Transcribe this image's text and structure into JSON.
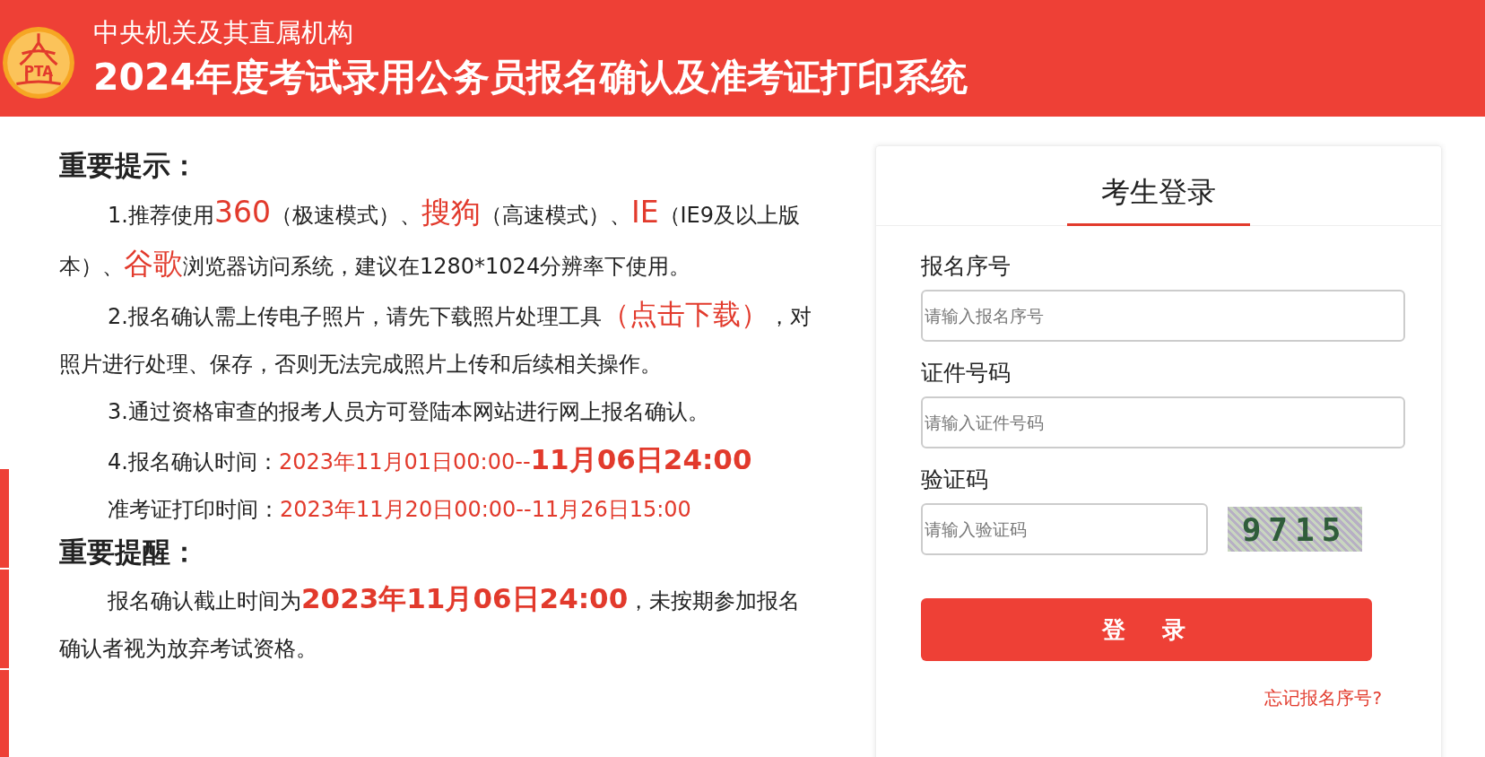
{
  "header": {
    "logo_text": "PTA",
    "subtitle": "中央机关及其直属机构",
    "title": "2024年度考试录用公务员报名确认及准考证打印系统"
  },
  "side_tabs": [
    {
      "kind": "tab"
    },
    {
      "kind": "tab"
    },
    {
      "kind": "tab"
    }
  ],
  "notice": {
    "heading": "重要提示：",
    "paragraphs": [
      {
        "segments": [
          {
            "kind": "plain",
            "text": "1.推荐使用"
          },
          {
            "kind": "highlight",
            "text": "360"
          },
          {
            "kind": "plain",
            "text": "（极速模式）、"
          },
          {
            "kind": "highlight",
            "text": "搜狗"
          },
          {
            "kind": "plain",
            "text": "（高速模式）、"
          },
          {
            "kind": "highlight",
            "text": "IE"
          },
          {
            "kind": "plain",
            "text": "（IE9及以上版本）、"
          },
          {
            "kind": "highlight",
            "text": "谷歌"
          },
          {
            "kind": "plain",
            "text": "浏览器访问系统，建议在1280*1024分辨率下使用。"
          }
        ]
      },
      {
        "segments": [
          {
            "kind": "plain",
            "text": "2.报名确认需上传电子照片，请先下载照片处理工具"
          },
          {
            "kind": "link",
            "text": "（点击下载）"
          },
          {
            "kind": "plain",
            "text": "，对照片进行处理、保存，否则无法完成照片上传和后续相关操作。"
          }
        ]
      },
      {
        "segments": [
          {
            "kind": "plain",
            "text": "3.通过资格审查的报考人员方可登陆本网站进行网上报名确认。"
          }
        ]
      },
      {
        "segments": [
          {
            "kind": "plain",
            "text": "4.报名确认时间："
          },
          {
            "kind": "date",
            "text": "2023年11月01日00:00--"
          },
          {
            "kind": "emphasis",
            "text": "11月06日24:00"
          }
        ]
      },
      {
        "segments": [
          {
            "kind": "plain",
            "text": "准考证打印时间："
          },
          {
            "kind": "date",
            "text": "2023年11月20日00:00--11月26日15:00"
          }
        ]
      }
    ]
  },
  "reminder": {
    "heading": "重要提醒：",
    "paragraphs": [
      {
        "segments": [
          {
            "kind": "plain",
            "text": "报名确认截止时间为"
          },
          {
            "kind": "emphasis",
            "text": "2023年11月06日24:00"
          },
          {
            "kind": "plain",
            "text": "，未按期参加报名确认者视为放弃考试资格。"
          }
        ]
      }
    ]
  },
  "login": {
    "title": "考生登录",
    "fields": [
      {
        "label": "报名序号",
        "placeholder": "请输入报名序号"
      },
      {
        "label": "证件号码",
        "placeholder": "请输入证件号码"
      }
    ],
    "captcha": {
      "label": "验证码",
      "placeholder": "请输入验证码",
      "code": "9715"
    },
    "submit": "登录",
    "forgot_link": "忘记报名序号?"
  }
}
